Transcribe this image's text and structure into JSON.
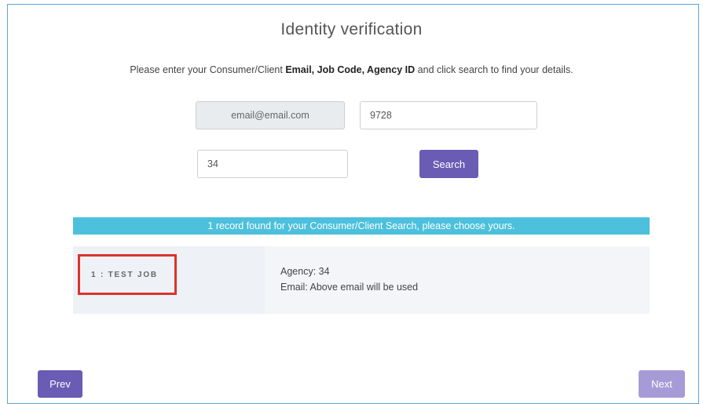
{
  "page": {
    "title": "Identity verification",
    "instruction": {
      "prefix": "Please enter your Consumer/Client ",
      "bold": "Email, Job Code, Agency ID",
      "suffix": " and click search to find your details."
    }
  },
  "form": {
    "email_value": "email@email.com",
    "job_code_value": "9728",
    "agency_id_value": "34",
    "search_label": "Search"
  },
  "results": {
    "banner": "1 record found for your Consumer/Client Search, please choose yours.",
    "records": [
      {
        "job": "1 : TEST JOB",
        "agency": "Agency: 34",
        "email": "Email: Above email will be used"
      }
    ]
  },
  "nav": {
    "prev_label": "Prev",
    "next_label": "Next"
  },
  "colors": {
    "accent": "#6a5bb5",
    "banner": "#4cc0dc",
    "highlight": "#d9352b"
  }
}
